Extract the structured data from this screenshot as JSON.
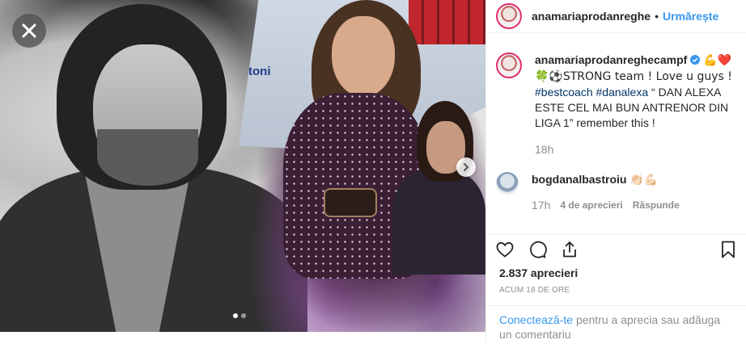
{
  "post": {
    "media": {
      "carousel_total": 2,
      "carousel_active_index": 0,
      "photo_text": "toni"
    },
    "header": {
      "username": "anamariaprodanreghe",
      "separator": "•",
      "follow_label": "Urmărește"
    },
    "caption": {
      "username": "anamariaprodanreghecampf",
      "verified": true,
      "emoji_1": "💪❤️",
      "line_1": "🍀⚽STRONG team ! Love u guys !",
      "hashtag_1": "#bestcoach",
      "hashtag_2": "#danalexa",
      "text_rest": " “ DAN ALEXA ESTE CEL MAI BUN ANTRENOR DIN LIGA 1” remember this !",
      "time": "18h"
    },
    "comments": [
      {
        "username": "bogdanalbastroiu",
        "text": "👏🏻💪🏻",
        "time": "17h",
        "likes": "4 de aprecieri",
        "reply": "Răspunde"
      }
    ],
    "likes_count": "2.837 aprecieri",
    "timestamp": "ACUM 18 DE ORE",
    "login_prompt": {
      "link": "Conectează-te",
      "rest": " pentru a aprecia sau adăuga un comentariu"
    }
  },
  "colors": {
    "link_blue": "#3897f0",
    "hashtag_blue": "#003569",
    "muted_text": "#8e8e8e",
    "avatar_ring": "#e1306c"
  },
  "icons": [
    "close-icon",
    "chevron-right-icon",
    "verified-icon",
    "heart-icon",
    "comment-icon",
    "share-icon",
    "bookmark-icon"
  ]
}
